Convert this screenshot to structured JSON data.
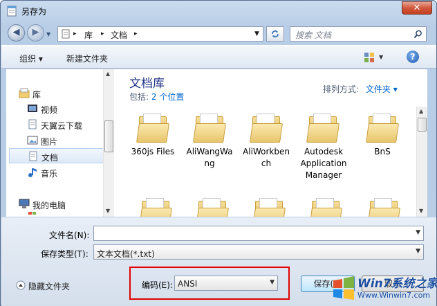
{
  "window": {
    "title": "另存为",
    "close_label": "✕"
  },
  "navbar": {
    "back": "◀",
    "forward": "▶",
    "breadcrumb": [
      "▸",
      "库",
      "▸",
      "文档",
      "▸"
    ],
    "search_placeholder": "搜索 文档"
  },
  "toolbar": {
    "organize_label": "组织 ▾",
    "new_folder_label": "新建文件夹",
    "help_label": "?"
  },
  "sidebar": {
    "items": [
      {
        "label": "库",
        "icon": "library-icon"
      },
      {
        "label": "视频",
        "icon": "video-icon"
      },
      {
        "label": "天翼云下载",
        "icon": "document-icon"
      },
      {
        "label": "图片",
        "icon": "picture-icon"
      },
      {
        "label": "文档",
        "icon": "document-icon"
      },
      {
        "label": "音乐",
        "icon": "music-icon"
      },
      {
        "label": "我的电脑",
        "icon": "computer-icon"
      }
    ]
  },
  "library": {
    "title": "文档库",
    "includes_label": "包括:",
    "includes_link": "2 个位置",
    "arrange_label": "排列方式:",
    "arrange_value": "文件夹 ▾"
  },
  "files": [
    {
      "name": "360js Files"
    },
    {
      "name": "AliWangWang"
    },
    {
      "name": "AliWorkbench"
    },
    {
      "name": "Autodesk Application Manager"
    },
    {
      "name": "BnS"
    }
  ],
  "form": {
    "filename_label": "文件名(N):",
    "filename_value": "",
    "filetype_label": "保存类型(T):",
    "filetype_value": "文本文档(*.txt)",
    "encoding_label": "编码(E):",
    "encoding_value": "ANSI",
    "hide_folders_label": "隐藏文件夹",
    "save_label": "保存(S)",
    "cancel_label": "取消"
  },
  "watermark": {
    "brand": "Win7系统之家",
    "url": "Www.Winwin7.com"
  },
  "colors": {
    "highlight": "#e00000",
    "link": "#0066cc",
    "folder": "#e8c66c"
  }
}
